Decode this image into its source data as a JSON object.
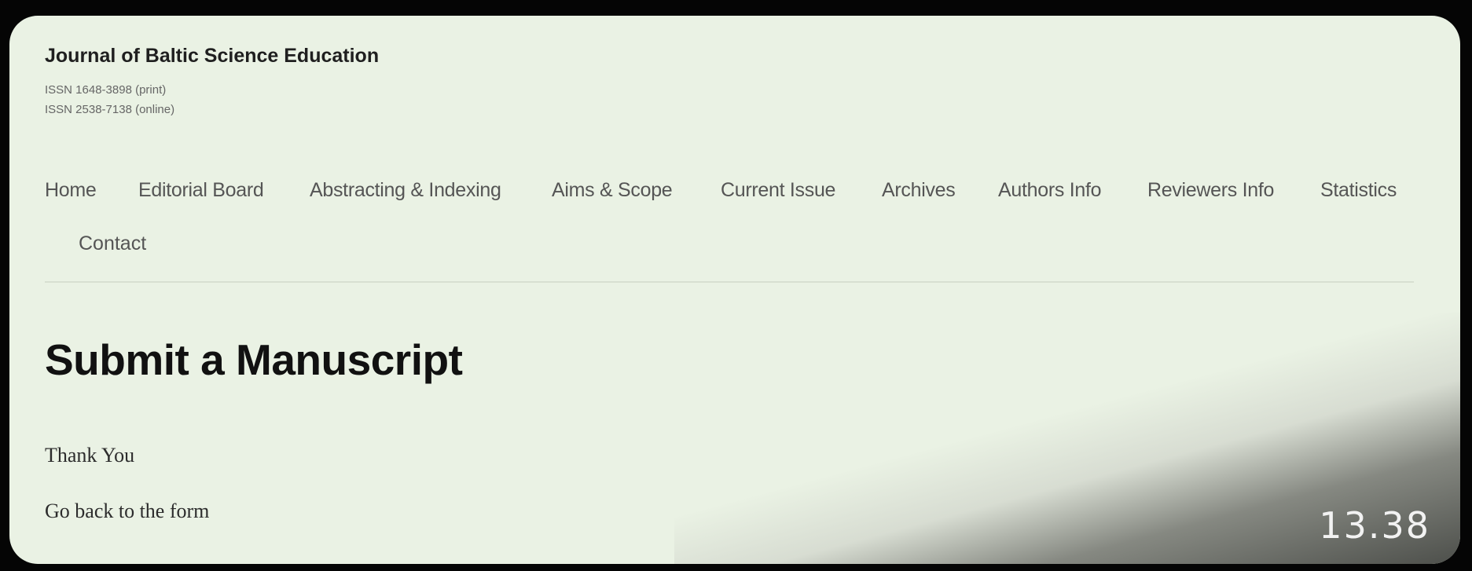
{
  "header": {
    "site_title": "Journal of Baltic Science Education",
    "issn_print": "ISSN 1648-3898 (print)",
    "issn_online": "ISSN 2538-7138 (online)"
  },
  "nav": {
    "items": [
      {
        "label": "Home"
      },
      {
        "label": "Editorial Board"
      },
      {
        "label": "Abstracting & Indexing"
      },
      {
        "label": "Aims & Scope"
      },
      {
        "label": "Current Issue"
      },
      {
        "label": "Archives"
      },
      {
        "label": "Authors Info"
      },
      {
        "label": "Reviewers Info"
      },
      {
        "label": "Statistics"
      },
      {
        "label": "Contact"
      }
    ]
  },
  "main": {
    "title": "Submit a Manuscript",
    "message": "Thank You",
    "back_link": "Go back to the form"
  },
  "overlay": {
    "timestamp": "13.38"
  },
  "colors": {
    "page_background": "#eaf2e4",
    "nav_text": "#555555",
    "title_text": "#111111"
  }
}
